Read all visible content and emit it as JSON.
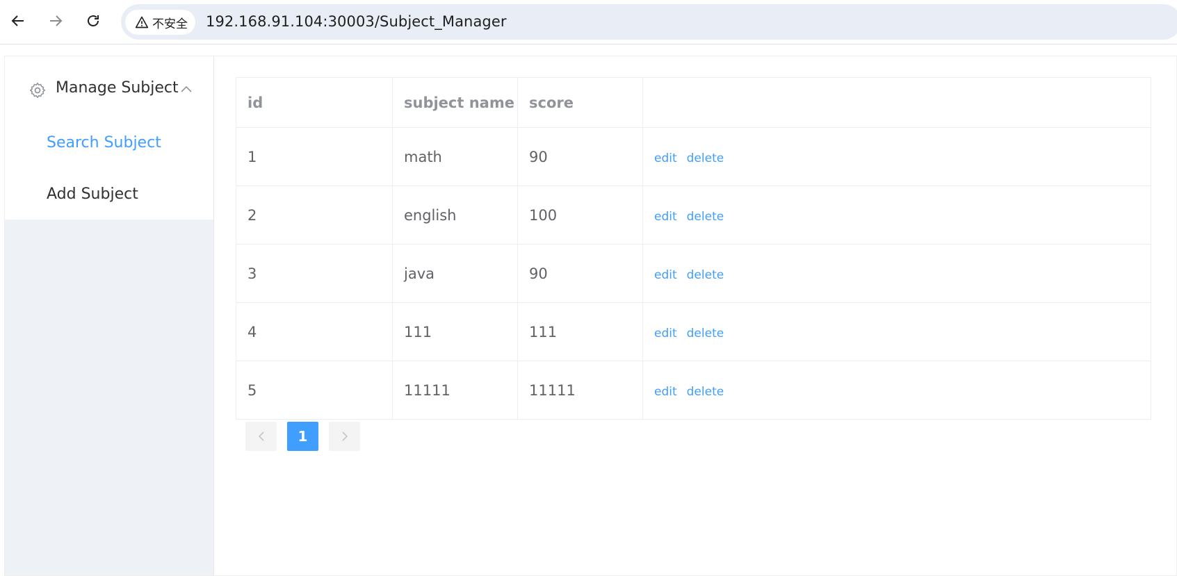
{
  "browser": {
    "security_label": "不安全",
    "url": "192.168.91.104:30003/Subject_Manager"
  },
  "sidebar": {
    "submenu_title": "Manage Subject",
    "items": [
      {
        "label": "Search Subject",
        "active": true
      },
      {
        "label": "Add Subject",
        "active": false
      }
    ],
    "active_color": "#409eff",
    "text_color": "#303133"
  },
  "table": {
    "headers": [
      "id",
      "subject name",
      "score",
      ""
    ],
    "rows": [
      {
        "id": "1",
        "name": "math",
        "score": "90"
      },
      {
        "id": "2",
        "name": "english",
        "score": "100"
      },
      {
        "id": "3",
        "name": "java",
        "score": "90"
      },
      {
        "id": "4",
        "name": "111",
        "score": "111"
      },
      {
        "id": "5",
        "name": "11111",
        "score": "11111"
      }
    ],
    "edit_label": "edit",
    "delete_label": "delete"
  },
  "pagination": {
    "current_page": "1",
    "prev_icon": "chevron-left-icon",
    "next_icon": "chevron-right-icon"
  }
}
